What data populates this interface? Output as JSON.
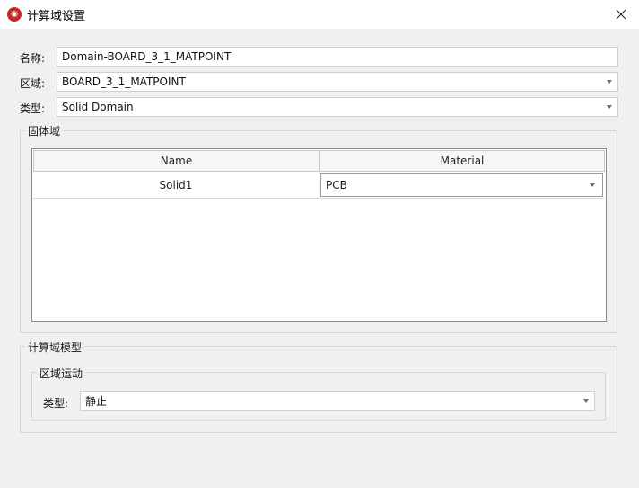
{
  "window": {
    "title": "计算域设置",
    "close_symbol": "✕"
  },
  "form": {
    "name_label": "名称:",
    "name_value": "Domain-BOARD_3_1_MATPOINT",
    "region_label": "区域:",
    "region_value": "BOARD_3_1_MATPOINT",
    "type_label": "类型:",
    "type_value": "Solid Domain"
  },
  "solid_domain": {
    "title": "固体域",
    "columns": [
      "Name",
      "Material"
    ],
    "rows": [
      {
        "name": "Solid1",
        "material": "PCB"
      }
    ]
  },
  "domain_model": {
    "title": "计算域模型",
    "motion": {
      "title": "区域运动",
      "type_label": "类型:",
      "type_value": "静止"
    }
  },
  "colors": {
    "background": "#f0f0f0",
    "titlebar": "#ffffff",
    "app_icon": "#c62828"
  }
}
